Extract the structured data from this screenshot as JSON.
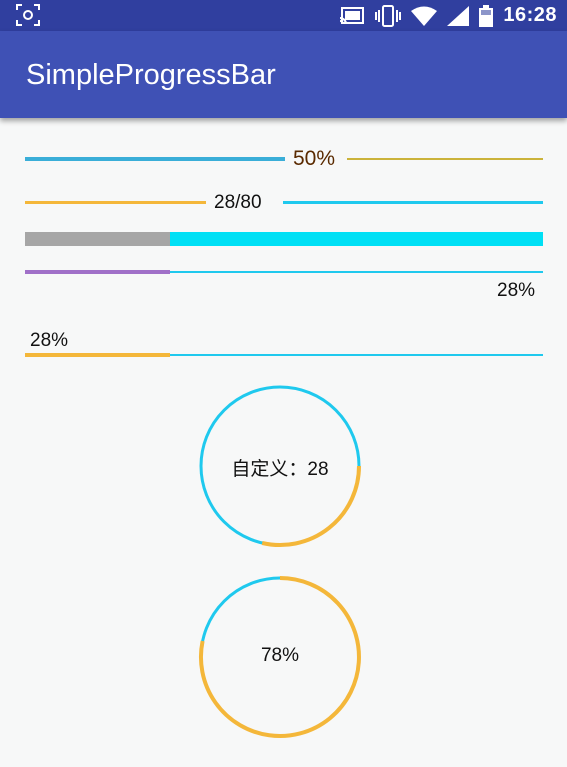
{
  "status_bar": {
    "time": "16:28",
    "icons": [
      "screen-capture-icon",
      "cast-icon",
      "vibrate-icon",
      "wifi-icon",
      "signal-icon",
      "battery-icon"
    ]
  },
  "app_bar": {
    "title": "SimpleProgressBar"
  },
  "colors": {
    "status_bar": "#303f9f",
    "app_bar": "#3f51b5",
    "blue": "#3aaed8",
    "cyan": "#1fc9ee",
    "bright_cyan": "#00e0f5",
    "yellow": "#f4b73a",
    "olive_yellow": "#cbb33b",
    "gray": "#a6a6a6",
    "purple": "#a070c8",
    "brown_text": "#5a2a00"
  },
  "progress_bars": [
    {
      "label": "50%",
      "progress": 0.5
    },
    {
      "label": "28/80",
      "progress": 0.35
    },
    {
      "progress": 0.28
    },
    {
      "label": "28%",
      "progress": 0.28
    },
    {
      "label": "28%",
      "progress": 0.28
    }
  ],
  "circles": [
    {
      "label": "自定义：28",
      "progress": 0.28
    },
    {
      "label": "78%",
      "progress": 0.78
    }
  ]
}
